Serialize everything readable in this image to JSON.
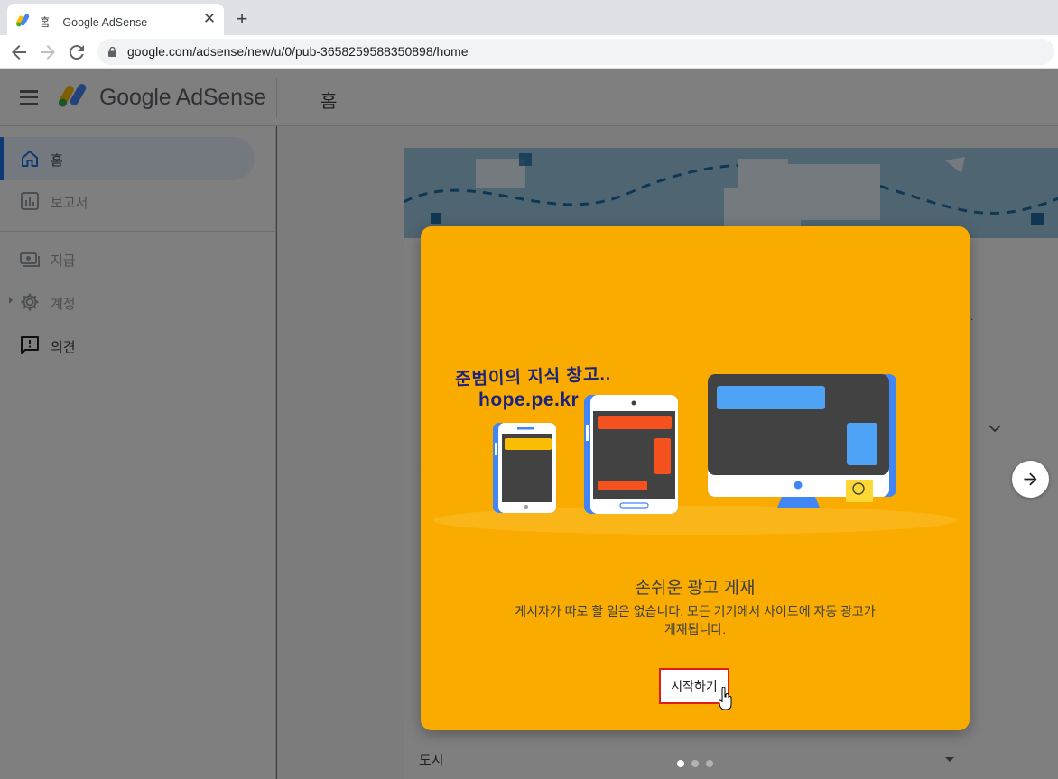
{
  "browser": {
    "tab_title": "홈 – Google AdSense",
    "tab_close": "✕",
    "new_tab": "+",
    "url": "google.com/adsense/new/u/0/pub-3658259588350898/home"
  },
  "header": {
    "brand": "Google AdSense",
    "page_title": "홈"
  },
  "sidebar": {
    "items": [
      {
        "label": "홈",
        "icon": "home-icon",
        "state": "active"
      },
      {
        "label": "보고서",
        "icon": "reports-icon",
        "state": "disabled"
      },
      {
        "label": "지급",
        "icon": "payments-icon",
        "state": "disabled"
      },
      {
        "label": "계정",
        "icon": "gear-icon",
        "state": "disabled"
      },
      {
        "label": "의견",
        "icon": "feedback-icon",
        "state": "normal"
      }
    ]
  },
  "background": {
    "city_label": "도시",
    "fragment_text": "."
  },
  "modal": {
    "overlay_line1": "준범이의 지식 창고..",
    "overlay_line2": "hope.pe.kr",
    "title": "손쉬운 광고 게재",
    "description": "게시자가 따로 할 일은 없습니다. 모든 기기에서 사이트에 자동 광고가 게재됩니다.",
    "start_button": "시작하기"
  },
  "carousel": {
    "total_pages": 3,
    "current_page": 1
  },
  "colors": {
    "modal_bg": "#f9ab00",
    "accent_blue": "#1a73e8",
    "highlight_red": "#e01b1b",
    "banner_blue": "#9ecbe3"
  }
}
